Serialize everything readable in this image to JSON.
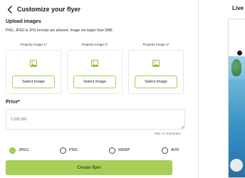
{
  "header": {
    "title": "Customize your flyer"
  },
  "upload": {
    "title": "Upload images",
    "hint": "PNG, JPEG & JPG formats are allowed. Image not larger than 5MB.",
    "cards": [
      {
        "label": "Property Image 1*",
        "button_label": "Select image"
      },
      {
        "label": "Property Image 2*",
        "button_label": "Select image"
      },
      {
        "label": "Property Image 3*",
        "button_label": "Select image"
      }
    ]
  },
  "price": {
    "label": "Price*",
    "placeholder": "1,595,000",
    "char_note": "Max 12 characters"
  },
  "formats": {
    "options": [
      {
        "label": "JPEG",
        "checked": true
      },
      {
        "label": "PNG",
        "checked": false
      },
      {
        "label": "WEBP",
        "checked": false
      },
      {
        "label": "AVIF",
        "checked": false
      }
    ]
  },
  "actions": {
    "create_label": "Create flyer"
  },
  "preview": {
    "title": "Live"
  },
  "colors": {
    "accent": "#a7cf55",
    "accent_border": "#a8cf5a",
    "radio_checked": "#a8d04a"
  },
  "icons": {
    "back": "chevron-left-icon",
    "image": "image-icon"
  }
}
